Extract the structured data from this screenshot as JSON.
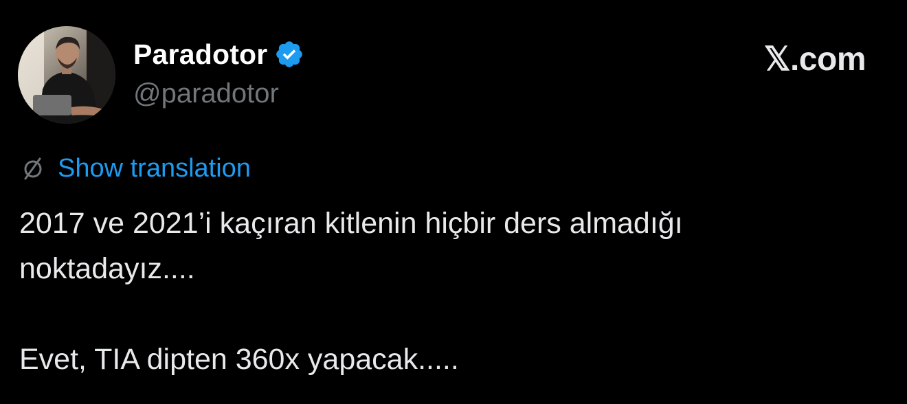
{
  "author": {
    "display_name": "Paradotor",
    "handle": "@paradotor",
    "verified": true
  },
  "brand": "𝕏.com",
  "translation": {
    "label": "Show translation"
  },
  "tweet": {
    "line1": "2017 ve 2021’i kaçıran kitlenin hiçbir ders almadığı",
    "line2": "noktadayız....",
    "line3": "Evet, TIA dipten 360x yapacak....."
  },
  "icons": {
    "verified": "verified-badge-icon",
    "translate": "translate-globe-icon"
  },
  "colors": {
    "background": "#000000",
    "link": "#1d9bf0",
    "secondary_text": "#71767b",
    "verified_badge": "#1d9bf0"
  }
}
